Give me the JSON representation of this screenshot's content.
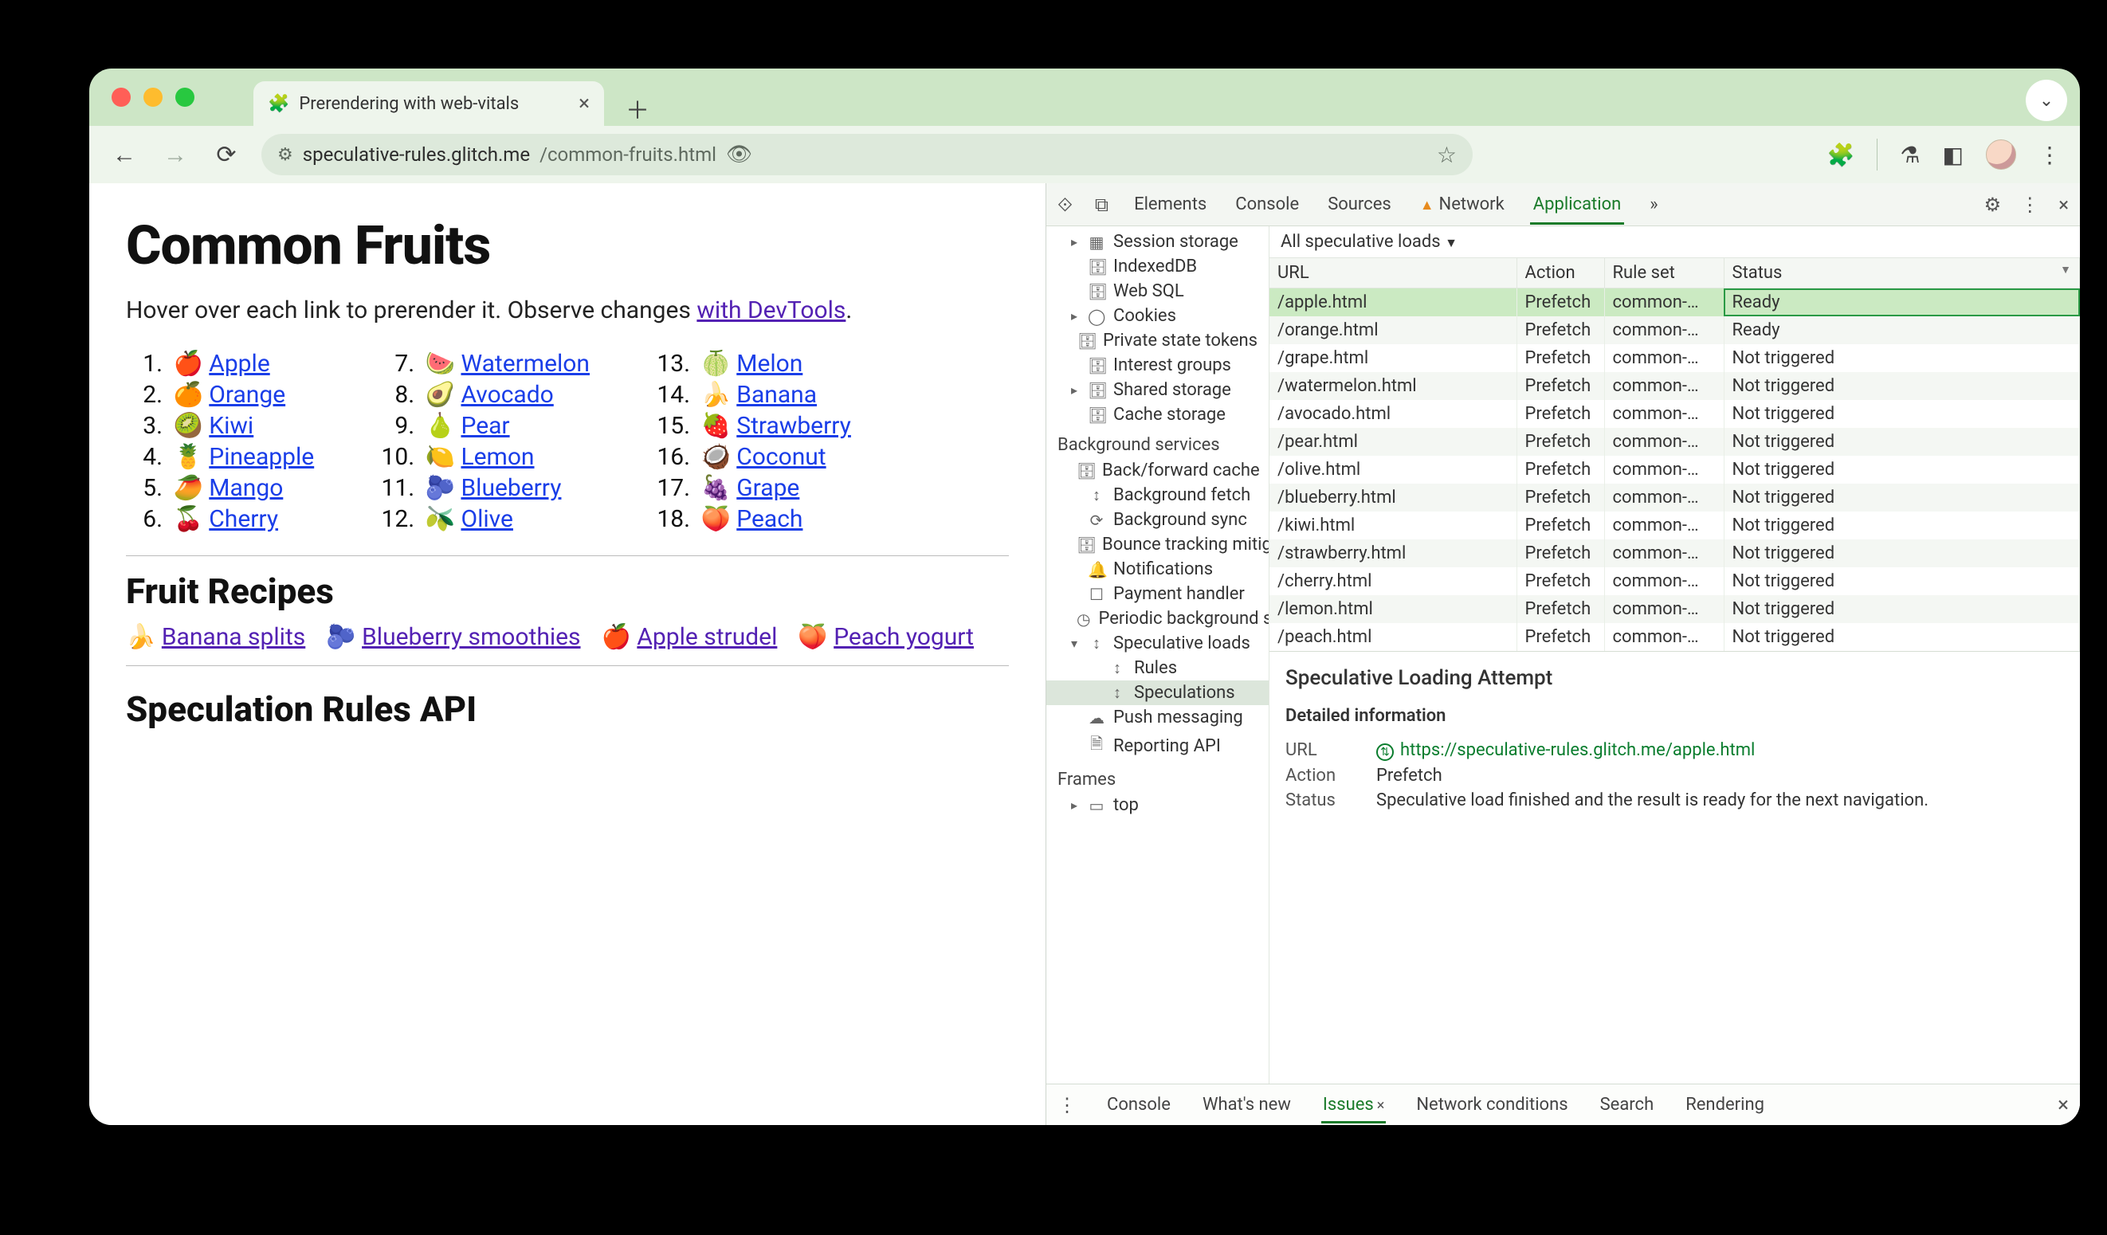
{
  "browser": {
    "tab_title": "Prerendering with web-vitals",
    "url_host": "speculative-rules.glitch.me",
    "url_path": "/common-fruits.html"
  },
  "page": {
    "h1": "Common Fruits",
    "lead_pre": "Hover over each link to prerender it. Observe changes ",
    "lead_link": "with DevTools",
    "lead_post": ".",
    "fruits": [
      {
        "n": "1.",
        "e": "🍎",
        "t": "Apple"
      },
      {
        "n": "2.",
        "e": "🍊",
        "t": "Orange"
      },
      {
        "n": "3.",
        "e": "🥝",
        "t": "Kiwi"
      },
      {
        "n": "4.",
        "e": "🍍",
        "t": "Pineapple"
      },
      {
        "n": "5.",
        "e": "🥭",
        "t": "Mango"
      },
      {
        "n": "6.",
        "e": "🍒",
        "t": "Cherry"
      },
      {
        "n": "7.",
        "e": "🍉",
        "t": "Watermelon"
      },
      {
        "n": "8.",
        "e": "🥑",
        "t": "Avocado"
      },
      {
        "n": "9.",
        "e": "🍐",
        "t": "Pear"
      },
      {
        "n": "10.",
        "e": "🍋",
        "t": "Lemon"
      },
      {
        "n": "11.",
        "e": "🫐",
        "t": "Blueberry"
      },
      {
        "n": "12.",
        "e": "🫒",
        "t": "Olive"
      },
      {
        "n": "13.",
        "e": "🍈",
        "t": "Melon"
      },
      {
        "n": "14.",
        "e": "🍌",
        "t": "Banana"
      },
      {
        "n": "15.",
        "e": "🍓",
        "t": "Strawberry"
      },
      {
        "n": "16.",
        "e": "🥥",
        "t": "Coconut"
      },
      {
        "n": "17.",
        "e": "🍇",
        "t": "Grape"
      },
      {
        "n": "18.",
        "e": "🍑",
        "t": "Peach"
      }
    ],
    "h2_recipes": "Fruit Recipes",
    "recipes": [
      {
        "e": "🍌",
        "t": "Banana splits"
      },
      {
        "e": "🫐",
        "t": "Blueberry smoothies"
      },
      {
        "e": "🍎",
        "t": "Apple strudel"
      },
      {
        "e": "🍑",
        "t": "Peach yogurt"
      }
    ],
    "h2_api": "Speculation Rules API"
  },
  "devtools": {
    "tabs": {
      "elements": "Elements",
      "console": "Console",
      "sources": "Sources",
      "network": "Network",
      "application": "Application",
      "more": "»"
    },
    "sidebar": {
      "storage": [
        {
          "caret": "▸",
          "glyph": "▦",
          "t": "Session storage"
        },
        {
          "caret": "",
          "glyph": "🗄",
          "t": "IndexedDB"
        },
        {
          "caret": "",
          "glyph": "🗄",
          "t": "Web SQL"
        },
        {
          "caret": "▸",
          "glyph": "◯",
          "t": "Cookies"
        },
        {
          "caret": "",
          "glyph": "🗄",
          "t": "Private state tokens"
        },
        {
          "caret": "",
          "glyph": "🗄",
          "t": "Interest groups"
        },
        {
          "caret": "▸",
          "glyph": "🗄",
          "t": "Shared storage"
        },
        {
          "caret": "",
          "glyph": "🗄",
          "t": "Cache storage"
        }
      ],
      "bg_title": "Background services",
      "bg": [
        {
          "glyph": "🗄",
          "t": "Back/forward cache"
        },
        {
          "glyph": "↕",
          "t": "Background fetch"
        },
        {
          "glyph": "⟳",
          "t": "Background sync"
        },
        {
          "glyph": "🗄",
          "t": "Bounce tracking mitigation"
        },
        {
          "glyph": "🔔",
          "t": "Notifications"
        },
        {
          "glyph": "☐",
          "t": "Payment handler"
        },
        {
          "glyph": "◷",
          "t": "Periodic background sync"
        }
      ],
      "spec": {
        "caret": "▾",
        "glyph": "↕",
        "t": "Speculative loads"
      },
      "spec_children": [
        {
          "glyph": "↕",
          "t": "Rules"
        },
        {
          "glyph": "↕",
          "t": "Speculations"
        }
      ],
      "after": [
        {
          "glyph": "☁",
          "t": "Push messaging"
        },
        {
          "glyph": "🗎",
          "t": "Reporting API"
        }
      ],
      "frames_title": "Frames",
      "frames": [
        {
          "caret": "▸",
          "glyph": "▭",
          "t": "top"
        }
      ]
    },
    "filter_label": "All speculative loads",
    "table": {
      "headers": {
        "url": "URL",
        "action": "Action",
        "ruleset": "Rule set",
        "status": "Status"
      },
      "ruleset_trunc": "common-…",
      "rows": [
        {
          "url": "/apple.html",
          "action": "Prefetch",
          "status": "Ready",
          "hl": true
        },
        {
          "url": "/orange.html",
          "action": "Prefetch",
          "status": "Ready"
        },
        {
          "url": "/grape.html",
          "action": "Prefetch",
          "status": "Not triggered"
        },
        {
          "url": "/watermelon.html",
          "action": "Prefetch",
          "status": "Not triggered"
        },
        {
          "url": "/avocado.html",
          "action": "Prefetch",
          "status": "Not triggered"
        },
        {
          "url": "/pear.html",
          "action": "Prefetch",
          "status": "Not triggered"
        },
        {
          "url": "/olive.html",
          "action": "Prefetch",
          "status": "Not triggered"
        },
        {
          "url": "/blueberry.html",
          "action": "Prefetch",
          "status": "Not triggered"
        },
        {
          "url": "/kiwi.html",
          "action": "Prefetch",
          "status": "Not triggered"
        },
        {
          "url": "/strawberry.html",
          "action": "Prefetch",
          "status": "Not triggered"
        },
        {
          "url": "/cherry.html",
          "action": "Prefetch",
          "status": "Not triggered"
        },
        {
          "url": "/lemon.html",
          "action": "Prefetch",
          "status": "Not triggered"
        },
        {
          "url": "/peach.html",
          "action": "Prefetch",
          "status": "Not triggered"
        }
      ]
    },
    "detail": {
      "title": "Speculative Loading Attempt",
      "section": "Detailed information",
      "url_k": "URL",
      "url_v": "https://speculative-rules.glitch.me/apple.html",
      "action_k": "Action",
      "action_v": "Prefetch",
      "status_k": "Status",
      "status_v": "Speculative load finished and the result is ready for the next navigation."
    },
    "drawer": {
      "console": "Console",
      "whatsnew": "What's new",
      "issues": "Issues",
      "netcond": "Network conditions",
      "search": "Search",
      "rendering": "Rendering"
    }
  }
}
